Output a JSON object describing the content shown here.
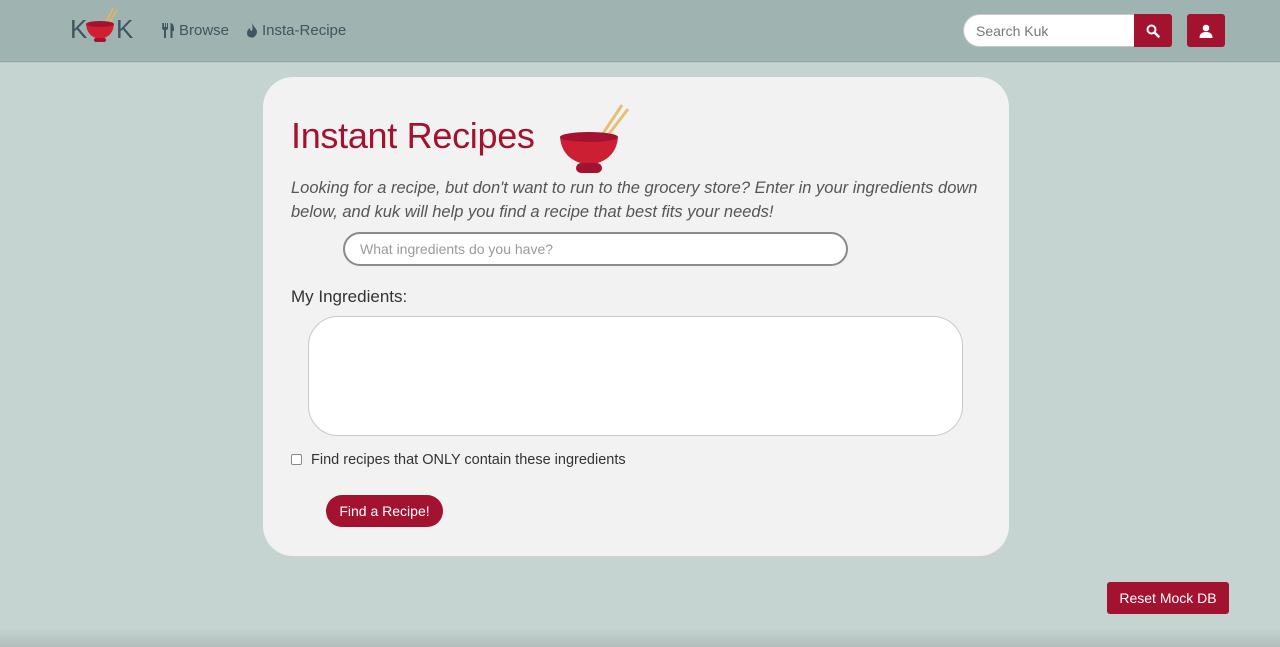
{
  "brand": {
    "logo_left": "K",
    "logo_right": "K"
  },
  "nav": {
    "browse_label": "Browse",
    "insta_label": "Insta-Recipe",
    "search_placeholder": "Search Kuk"
  },
  "card": {
    "title": "Instant Recipes",
    "description": "Looking for a recipe, but don't want to run to the grocery store? Enter in your ingredients down below, and kuk will help you find a recipe that best fits your needs!",
    "ingredient_placeholder": "What ingredients do you have?",
    "my_ingredients_label": "My Ingredients:",
    "only_checkbox_label": "Find recipes that ONLY contain these ingredients",
    "find_button_label": "Find a Recipe!"
  },
  "footer": {
    "reset_button_label": "Reset Mock DB"
  },
  "colors": {
    "accent": "#a3132f",
    "navbar": "#9fb3b0",
    "background": "#c5d3d1",
    "card": "#f1f2f1"
  },
  "icons": [
    "bowl-chopsticks-logo",
    "utensils-icon",
    "fire-icon",
    "search-icon",
    "user-icon",
    "bowl-icon"
  ]
}
